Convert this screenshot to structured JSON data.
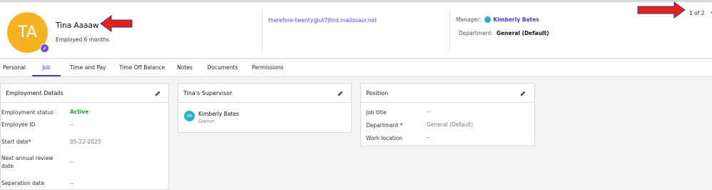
{
  "profile": {
    "initials": "TA",
    "name": "Tina Aaaaw",
    "tenure": "Employed 6 months",
    "email": "therefore-twenty@ut7jtrrd.mailosaur.net",
    "manager_label": "Manager:",
    "manager_name": "Kimberly Bates",
    "department_label": "Department:",
    "department_value": "General (Default)"
  },
  "pager": {
    "text": "1 of 2",
    "next_glyph": "›"
  },
  "tabs": [
    {
      "label": "Personal"
    },
    {
      "label": "Job",
      "active": true
    },
    {
      "label": "Time and Pay"
    },
    {
      "label": "Time Off Balance"
    },
    {
      "label": "Notes"
    },
    {
      "label": "Documents"
    },
    {
      "label": "Permissions"
    }
  ],
  "employment": {
    "title": "Employment Details",
    "rows": [
      {
        "label": "Employment status",
        "value": "Active"
      },
      {
        "label": "Employee ID",
        "value": "--"
      },
      {
        "label": "Start date*",
        "value": "05-22-2025"
      },
      {
        "label": "Next annual review date",
        "value": "--"
      },
      {
        "label": "Separation date",
        "value": "--"
      }
    ]
  },
  "supervisor": {
    "title": "Tina's Supervisor",
    "initials": "KB",
    "name": "Kimberly Bates",
    "role": "Owner"
  },
  "position": {
    "title": "Position",
    "rows": [
      {
        "label": "Job title",
        "value": "--"
      },
      {
        "label": "Department *",
        "value": "General (Default)"
      },
      {
        "label": "Work location",
        "value": "--"
      }
    ]
  },
  "colors": {
    "accent": "#4a3fc7",
    "avatar_bg": "#f5b324",
    "active_status": "#2e9e3a",
    "annotation_red": "#e8201a"
  }
}
